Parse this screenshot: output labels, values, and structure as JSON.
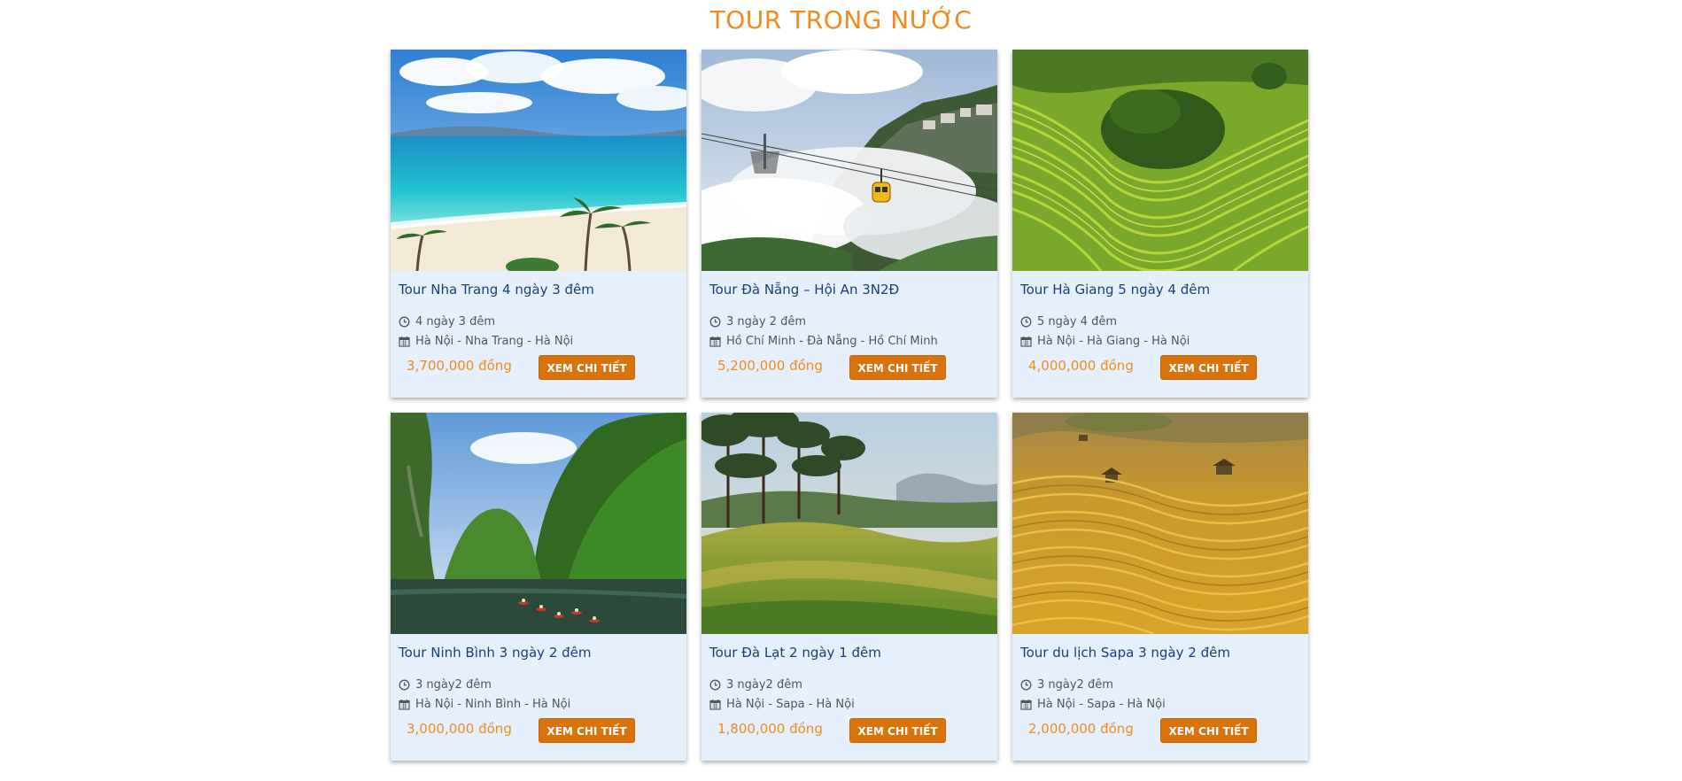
{
  "section": {
    "title": "TOUR TRONG NƯỚC"
  },
  "colors": {
    "accent": "#f28b1f",
    "button": "#d9740d",
    "card_bg": "#e5f0fc",
    "title_text": "#1a3f7a"
  },
  "tours": [
    {
      "title": "Tour Nha Trang 4 ngày 3 đêm",
      "duration": "4 ngày 3 đêm",
      "route": "Hà Nội - Nha Trang - Hà Nội",
      "price": "3,700,000 đồng",
      "button": "XEM CHI TIẾT",
      "image": "beach-photo"
    },
    {
      "title": "Tour Đà Nẵng – Hội An 3N2Đ",
      "duration": "3 ngày 2 đêm",
      "route": "Hồ Chí Minh - Đà Nẵng - Hồ Chí Minh",
      "price": "5,200,000 đồng",
      "button": "XEM CHI TIẾT",
      "image": "cable-car-photo"
    },
    {
      "title": "Tour Hà Giang 5 ngày 4 đêm",
      "duration": "5 ngày 4 đêm",
      "route": "Hà Nội - Hà Giang - Hà Nội",
      "price": "4,000,000 đồng",
      "button": "XEM CHI TIẾT",
      "image": "rice-terrace-green-photo"
    },
    {
      "title": "Tour Ninh Bình 3 ngày 2 đêm",
      "duration": "3 ngày2 đêm",
      "route": "Hà Nội - Ninh Bình - Hà Nội",
      "price": "3,000,000 đồng",
      "button": "XEM CHI TIẾT",
      "image": "river-karst-photo"
    },
    {
      "title": "Tour Đà Lạt 2 ngày 1 đêm",
      "duration": "3 ngày2 đêm",
      "route": "Hà Nội - Sapa - Hà Nội",
      "price": "1,800,000 đồng",
      "button": "XEM CHI TIẾT",
      "image": "pine-hill-photo"
    },
    {
      "title": "Tour du lịch Sapa 3 ngày 2 đêm",
      "duration": "3 ngày2 đêm",
      "route": "Hà Nội - Sapa - Hà Nội",
      "price": "2,000,000 đồng",
      "button": "XEM CHI TIẾT",
      "image": "rice-terrace-golden-photo"
    }
  ]
}
